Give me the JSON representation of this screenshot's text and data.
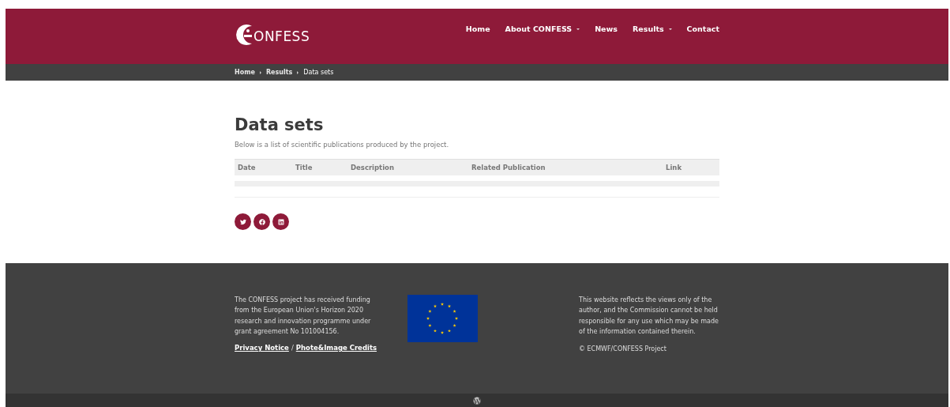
{
  "header": {
    "logo_text": "ONFESS",
    "nav": [
      {
        "label": "Home",
        "has_menu": false
      },
      {
        "label": "About CONFESS",
        "has_menu": true
      },
      {
        "label": "News",
        "has_menu": false
      },
      {
        "label": "Results",
        "has_menu": true
      },
      {
        "label": "Contact",
        "has_menu": false
      }
    ]
  },
  "breadcrumb": [
    "Home",
    "Results",
    "Data sets"
  ],
  "page": {
    "title": "Data sets",
    "intro": "Below is a list of scientific publications produced by the project.",
    "table": {
      "columns": [
        "Date",
        "Title",
        "Description",
        "Related Publication",
        "Link"
      ]
    },
    "social": [
      {
        "kind": "twitter"
      },
      {
        "kind": "facebook"
      },
      {
        "kind": "linkedin"
      }
    ]
  },
  "footer": {
    "funding": "The CONFESS project has received funding from the European Union's Horizon 2020 research and innovation programme under grant agreement No 101004156.",
    "links": [
      "Privacy Notice",
      "Phote&Image Credits"
    ],
    "separator": "/",
    "disclaimer": "This website reflects the views only of the author, and the Commission cannot be held responsible for any use which may be made of the information contained therein.",
    "copyright": "© ECMWF/CONFESS Project"
  }
}
